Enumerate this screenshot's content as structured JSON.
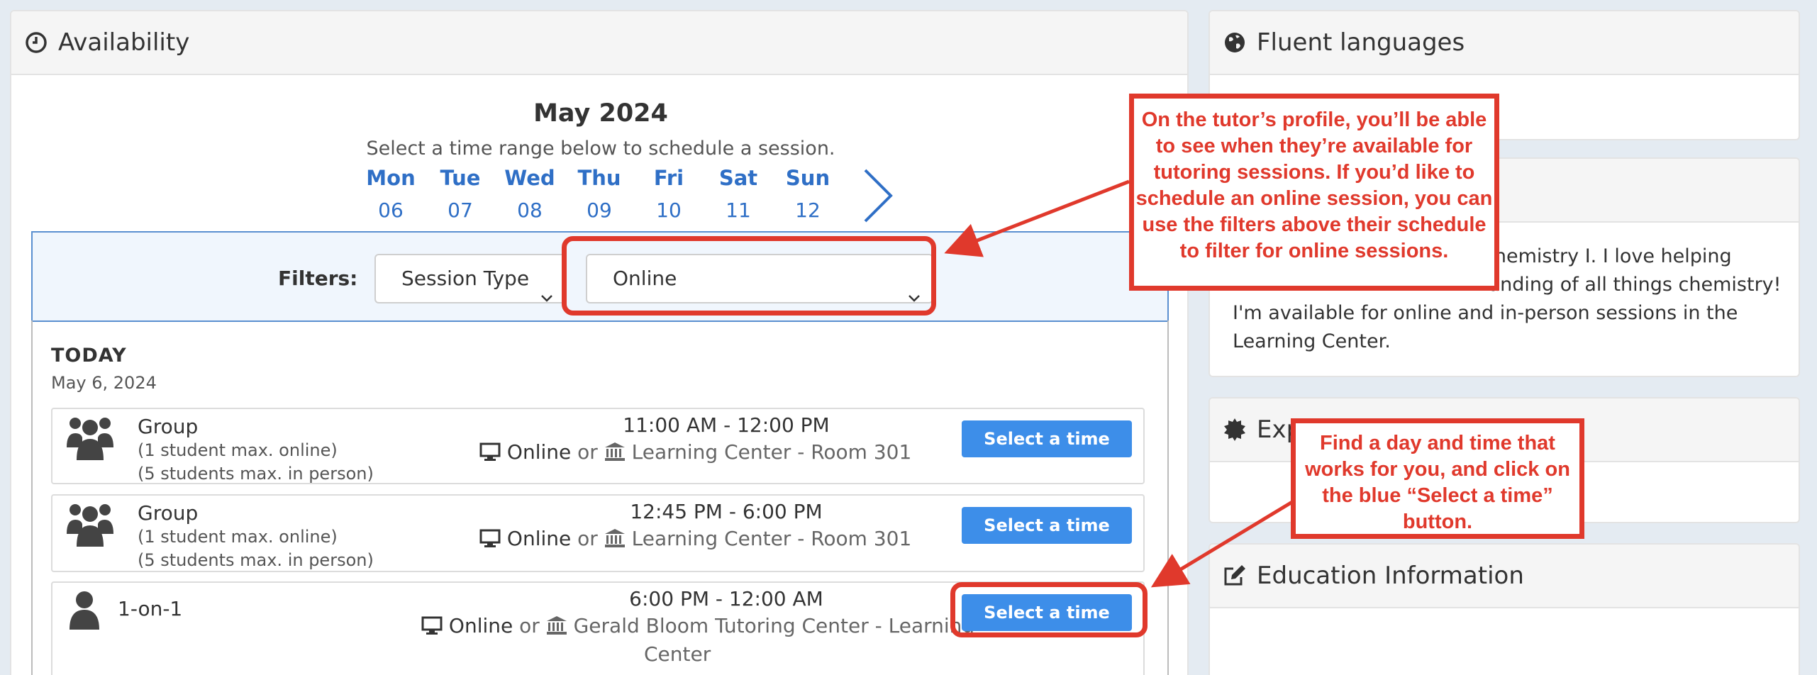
{
  "availability": {
    "title": "Availability",
    "month": "May 2024",
    "subtitle": "Select a time range below to schedule a session.",
    "days": [
      {
        "name": "Mon",
        "num": "06"
      },
      {
        "name": "Tue",
        "num": "07"
      },
      {
        "name": "Wed",
        "num": "08"
      },
      {
        "name": "Thu",
        "num": "09"
      },
      {
        "name": "Fri",
        "num": "10"
      },
      {
        "name": "Sat",
        "num": "11"
      },
      {
        "name": "Sun",
        "num": "12"
      }
    ],
    "filters": {
      "label": "Filters:",
      "session_type": "Session Type",
      "location": "Online"
    },
    "today_label": "TODAY",
    "today_date": "May 6, 2024",
    "sessions": [
      {
        "type": "Group",
        "cap1": "(1 student max. online)",
        "cap2": "(5 students max. in person)",
        "time": "11:00 AM - 12:00 PM",
        "online": "Online",
        "or": "or",
        "location": "Learning Center - Room 301",
        "location_cont": "",
        "button": "Select a time"
      },
      {
        "type": "Group",
        "cap1": "(1 student max. online)",
        "cap2": "(5 students max. in person)",
        "time": "12:45 PM - 6:00 PM",
        "online": "Online",
        "or": "or",
        "location": "Learning Center - Room 301",
        "location_cont": "",
        "button": "Select a time"
      },
      {
        "type": "1-on-1",
        "cap1": "",
        "cap2": "",
        "time": "6:00 PM - 12:00 AM",
        "online": "Online",
        "or": "or",
        "location": "Gerald Bloom Tutoring Center - Learning",
        "location_cont": "Center",
        "button": "Select a time"
      }
    ]
  },
  "fluent_languages": {
    "title": "Fluent languages"
  },
  "about": {
    "line1": "Chemistry I. I love helping",
    "line2": "tanding of all things chemistry!",
    "line3": "I'm available for online and in-person sessions in the",
    "line4": "Learning Center."
  },
  "expertise": {
    "title": "Exp"
  },
  "education": {
    "title": "Education Information"
  },
  "annotations": {
    "filters_callout": "On the tutor’s profile, you’ll be able to see when they’re available for tutoring sessions. If you’d like to schedule an online session, you can use the filters above their schedule to filter for online sessions.",
    "select_callout": "Find a day and time that works for you, and click on the blue “Select a time” button."
  },
  "colors": {
    "accent_blue": "#3d8ee9",
    "day_blue": "#2f6fc6",
    "annotation_red": "#e0392c",
    "page_bg": "#e4ebf2"
  }
}
